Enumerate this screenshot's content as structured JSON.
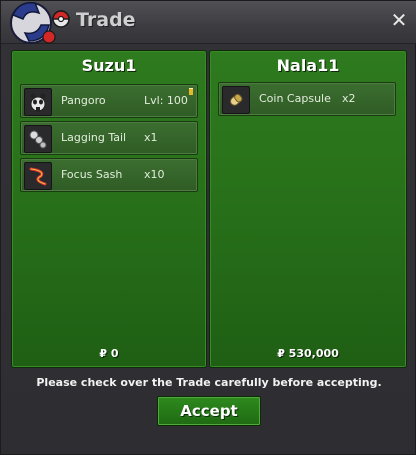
{
  "window": {
    "title": "Trade",
    "close_icon": "close-icon"
  },
  "colors": {
    "panel_green": "#28711a",
    "accent_green": "#2e8a1e",
    "background": "#2e2e32"
  },
  "left_panel": {
    "player": "Suzu1",
    "items": [
      {
        "name": "Pangoro",
        "qty": "Lvl: 100",
        "icon": "pangoro-icon",
        "flag": true
      },
      {
        "name": "Lagging Tail",
        "qty": "x1",
        "icon": "lagging-tail-icon"
      },
      {
        "name": "Focus Sash",
        "qty": "x10",
        "icon": "focus-sash-icon"
      }
    ],
    "money": "₽ 0"
  },
  "right_panel": {
    "player": "Nala11",
    "items": [
      {
        "name": "Coin Capsule",
        "qty": "x2",
        "icon": "coin-capsule-icon"
      }
    ],
    "money": "₽ 530,000"
  },
  "notice": "Please check over the Trade carefully before accepting.",
  "accept_label": "Accept"
}
